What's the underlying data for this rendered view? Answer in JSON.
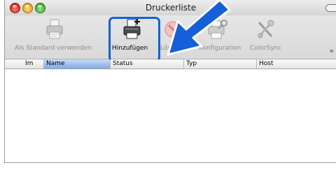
{
  "window": {
    "title": "Druckerliste"
  },
  "toolbar": {
    "items": [
      {
        "label": "Als Standard verwenden",
        "icon": "printer-default-icon",
        "enabled": false
      },
      {
        "label": "Hinzufügen",
        "icon": "printer-add-icon",
        "enabled": true
      },
      {
        "label": "Löschen",
        "icon": "delete-icon",
        "enabled": false
      },
      {
        "label": "Konfiguration",
        "icon": "configuration-icon",
        "enabled": false
      },
      {
        "label": "ColorSync",
        "icon": "colorsync-icon",
        "enabled": false
      }
    ],
    "overflow": "»"
  },
  "table": {
    "columns": [
      "Im",
      "Name",
      "Status",
      "Typ",
      "Host"
    ],
    "sorted_column": "Name",
    "rows": []
  },
  "colors": {
    "highlight": "#1560d8",
    "arrow": "#1560d8",
    "sorted_header": "#7fa8e6"
  }
}
